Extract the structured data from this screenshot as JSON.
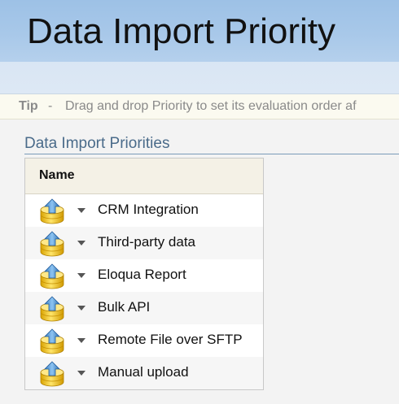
{
  "header": {
    "title": "Data Import Priority"
  },
  "tip": {
    "label": "Tip",
    "separator": "-",
    "text": "Drag and drop Priority to set its evaluation order af"
  },
  "section": {
    "title": "Data Import Priorities"
  },
  "grid": {
    "column_header": "Name",
    "rows": [
      {
        "label": "CRM Integration",
        "icon": "database-upload-icon"
      },
      {
        "label": "Third-party data",
        "icon": "database-upload-icon"
      },
      {
        "label": "Eloqua Report",
        "icon": "database-upload-icon"
      },
      {
        "label": "Bulk API",
        "icon": "database-upload-icon"
      },
      {
        "label": "Remote File over SFTP",
        "icon": "database-upload-icon"
      },
      {
        "label": "Manual upload",
        "icon": "database-upload-icon"
      }
    ]
  },
  "colors": {
    "header_blue": "#a8c8e9",
    "section_title": "#4a6b8a",
    "tip_text": "#8a8a8a"
  }
}
